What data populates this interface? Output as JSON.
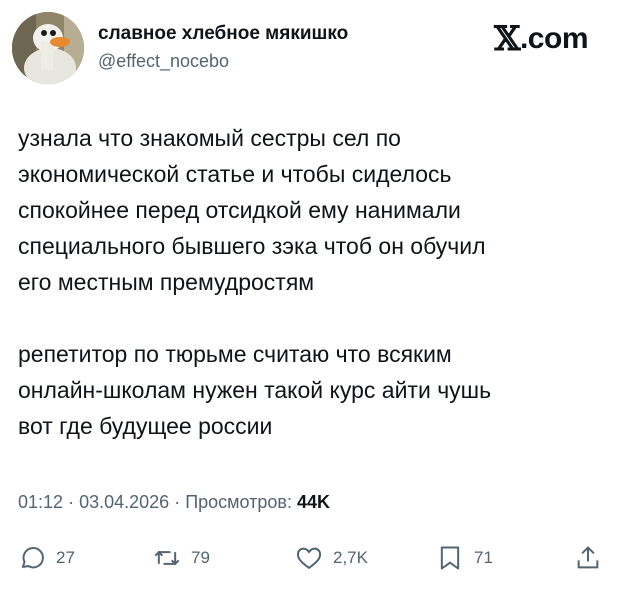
{
  "author": {
    "display_name": "славное хлебное мякишко",
    "handle": "@effect_nocebo",
    "avatar_icon": "goose-avatar-icon"
  },
  "brand": {
    "x_glyph": "𝕏",
    "suffix": ".com"
  },
  "tweet": {
    "paragraphs": [
      "узнала что знакомый сестры сел по\nэкономической статье и чтобы сиделось\nспокойнее перед отсидкой ему нанимали\nспециального бывшего зэка чтоб он обучил\nего местным премудростям",
      "репетитор по тюрьме считаю что всяким\nонлайн-школам нужен такой курс айти чушь\nвот где будущее россии"
    ],
    "time": "01:12",
    "separator": "·",
    "date": "03.04.2026",
    "views_label": "Просмотров:",
    "views_count": "44K"
  },
  "actions": {
    "replies": "27",
    "reposts": "79",
    "likes": "2,7K",
    "bookmarks": "71"
  },
  "colors": {
    "text": "#0f1419",
    "secondary": "#536471",
    "background": "#ffffff"
  }
}
